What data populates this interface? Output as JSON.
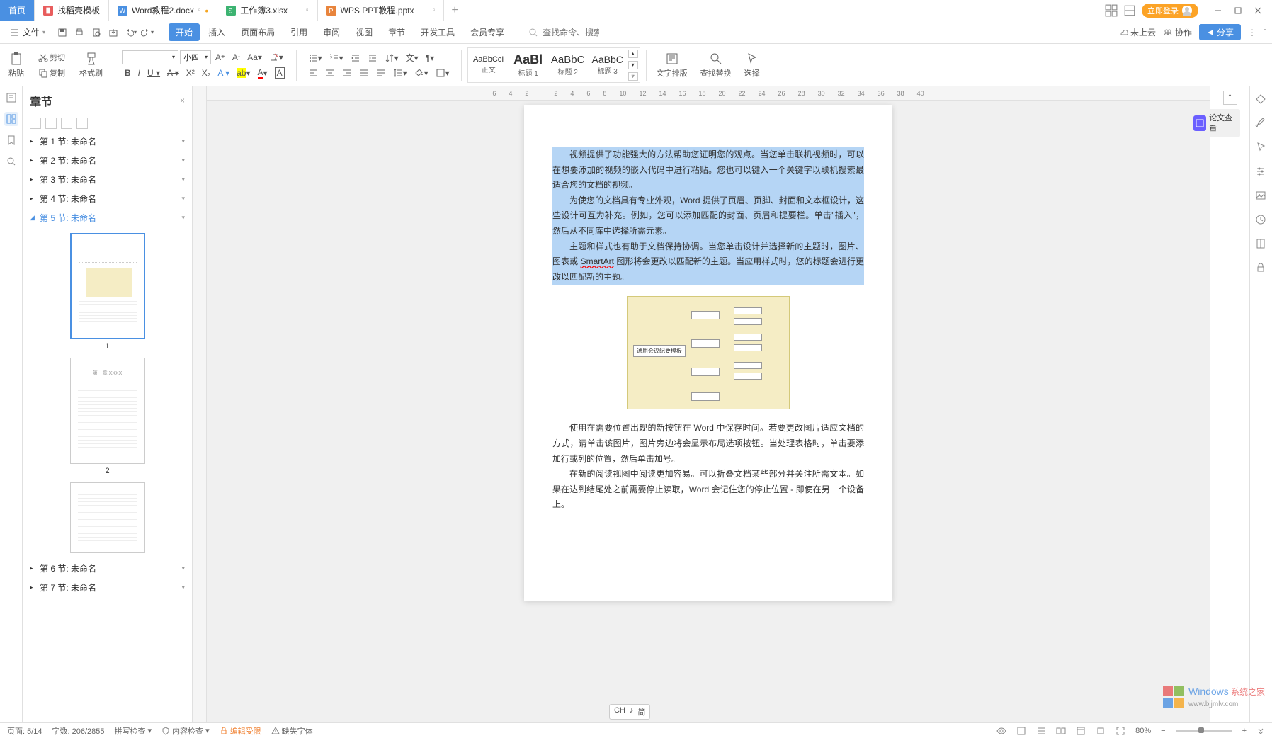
{
  "titlebar": {
    "home": "首页",
    "tabs": [
      {
        "name": "找稻壳模板",
        "icon": "#e85d5d"
      },
      {
        "name": "Word教程2.docx",
        "icon": "#4a90e2",
        "active": true,
        "modified": true
      },
      {
        "name": "工作簿3.xlsx",
        "icon": "#3cb371"
      },
      {
        "name": "WPS PPT教程.pptx",
        "icon": "#e8843c"
      }
    ],
    "login": "立即登录"
  },
  "menubar": {
    "file": "文件",
    "tabs": [
      "开始",
      "插入",
      "页面布局",
      "引用",
      "审阅",
      "视图",
      "章节",
      "开发工具",
      "会员专享"
    ],
    "active_tab": "开始",
    "search_placeholder": "查找命令、搜索模板",
    "cloud": "未上云",
    "coop": "协作",
    "share": "分享"
  },
  "ribbon": {
    "paste": "粘贴",
    "cut": "剪切",
    "copy": "复制",
    "format_painter": "格式刷",
    "font_name": "",
    "font_size": "小四",
    "styles": [
      {
        "preview": "AaBbCcI",
        "label": "正文",
        "weight": "normal",
        "size": "12px"
      },
      {
        "preview": "AaBl",
        "label": "标题 1",
        "weight": "bold",
        "size": "18px"
      },
      {
        "preview": "AaBbC",
        "label": "标题 2",
        "weight": "normal",
        "size": "15px"
      },
      {
        "preview": "AaBbC",
        "label": "标题 3",
        "weight": "normal",
        "size": "14px"
      }
    ],
    "text_layout": "文字排版",
    "find_replace": "查找替换",
    "select": "选择"
  },
  "sidebar": {
    "title": "章节",
    "sections": [
      "第 1 节: 未命名",
      "第 2 节: 未命名",
      "第 3 节: 未命名",
      "第 4 节: 未命名",
      "第 5 节: 未命名",
      "第 6 节: 未命名",
      "第 7 节: 未命名"
    ],
    "active_section": 4,
    "thumb_nums": [
      "1",
      "2"
    ]
  },
  "ruler_h": [
    "6",
    "4",
    "2",
    "",
    "2",
    "4",
    "6",
    "8",
    "10",
    "12",
    "14",
    "16",
    "18",
    "20",
    "22",
    "24",
    "26",
    "28",
    "30",
    "32",
    "34",
    "36",
    "38",
    "40"
  ],
  "document": {
    "p1": "视频提供了功能强大的方法帮助您证明您的观点。当您单击联机视频时，可以在想要添加的视频的嵌入代码中进行粘贴。您也可以键入一个关键字以联机搜索最适合您的文档的视频。",
    "p2": "为使您的文档具有专业外观，Word 提供了页眉、页脚、封面和文本框设计，这些设计可互为补充。例如，您可以添加匹配的封面、页眉和提要栏。单击\"插入\"，然后从不同库中选择所需元素。",
    "p3a": "主题和样式也有助于文档保持协调。当您单击设计并选择新的主题时，图片、图表或 ",
    "p3b": "SmartArt",
    "p3c": " 图形将会更改以匹配新的主题。当应用样式时，您的标题会进行更改以匹配新的主题。",
    "p4": "使用在需要位置出现的新按钮在 Word 中保存时间。若要更改图片适应文档的方式，请单击该图片，图片旁边将会显示布局选项按钮。当处理表格时，单击要添加行或列的位置，然后单击加号。",
    "p5": "在新的阅读视图中阅读更加容易。可以折叠文档某些部分并关注所需文本。如果在达到结尾处之前需要停止读取，Word 会记住您的停止位置 - 即使在另一个设备上。",
    "diagram_center": "通用会议纪要模板"
  },
  "right_pane": {
    "doc_check": "论文查重"
  },
  "statusbar": {
    "page": "页面: 5/14",
    "words": "字数: 206/2855",
    "spell": "拼写检查",
    "content": "内容检查",
    "edit_restrict": "编辑受限",
    "missing_font": "缺失字体",
    "zoom": "80%"
  },
  "ime": {
    "a": "CH",
    "b": "♪",
    "c": "简"
  },
  "watermark": {
    "a": "Windows",
    "b": "系统之家",
    "c": "www.bjjmlv.com"
  }
}
